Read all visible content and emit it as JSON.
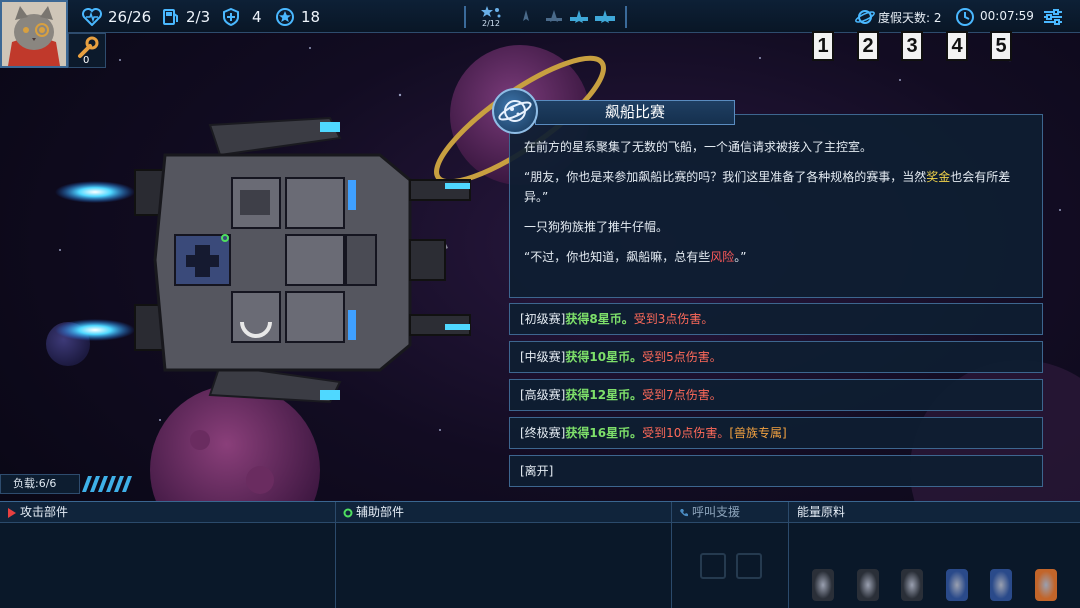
{
  "topbar": {
    "hull": "26/26",
    "fuel": "2/3",
    "shield": "4",
    "stars": "18",
    "sector": "2/12",
    "vacation_days": "度假天数: 2",
    "time": "00:07:59"
  },
  "tool_count": "0",
  "event": {
    "title": "飙船比赛",
    "paragraph1": "在前方的星系聚集了无数的飞船，一个通信请求被接入了主控室。",
    "paragraph2_pre": "“朋友，你也是来参加飙船比赛的吗？我们这里准备了各种规格的赛事，当然",
    "paragraph2_highlight": "奖金",
    "paragraph2_post": "也会有所差异。”",
    "paragraph3": "一只狗狗族推了推牛仔帽。",
    "paragraph4_pre": "“不过，你也知道，飙船嘛，总有些",
    "paragraph4_highlight": "风险",
    "paragraph4_post": "。”"
  },
  "options": [
    {
      "tag": "[初级赛]",
      "reward": "获得8星币。",
      "damage": "受到3点伤害。",
      "extra": ""
    },
    {
      "tag": "[中级赛]",
      "reward": "获得10星币。",
      "damage": "受到5点伤害。",
      "extra": ""
    },
    {
      "tag": "[高级赛]",
      "reward": "获得12星币。",
      "damage": "受到7点伤害。",
      "extra": ""
    },
    {
      "tag": "[终极赛]",
      "reward": "获得16星币。",
      "damage": "受到10点伤害。",
      "extra": "[兽族专属]"
    },
    {
      "tag": "[离开]",
      "reward": "",
      "damage": "",
      "extra": ""
    }
  ],
  "load": "负载:6/6",
  "bottom": {
    "attack": "攻击部件",
    "support": "辅助部件",
    "call": "呼叫支援",
    "energy": "能量原料",
    "energy_slots": [
      "1",
      "2",
      "3",
      "4",
      "5"
    ]
  },
  "colors": {
    "accent_gold": "#f0d24a",
    "danger_red": "#ff5a5a",
    "reward_green": "#7ee06a",
    "exclusive_orange": "#f0a040",
    "panel_border": "#3d668f"
  },
  "cards": [
    {
      "color": "#2a2f38"
    },
    {
      "color": "#2a2f38"
    },
    {
      "color": "#2a2f38"
    },
    {
      "color": "#2a4a8a"
    },
    {
      "color": "#2a4a8a"
    },
    {
      "color": "#c2652a"
    }
  ]
}
